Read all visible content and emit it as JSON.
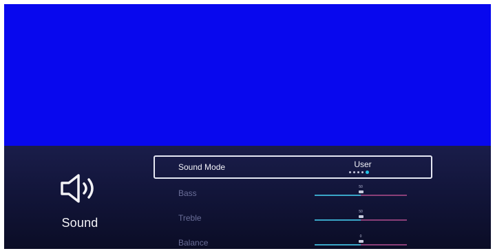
{
  "category": {
    "label": "Sound",
    "icon": "speaker-volume-icon"
  },
  "menu": {
    "sound_mode": {
      "label": "Sound Mode",
      "value": "User",
      "option_count": 5,
      "selected_index": 4
    },
    "bass": {
      "label": "Bass",
      "value": "50",
      "level": 0.5
    },
    "treble": {
      "label": "Treble",
      "value": "50",
      "level": 0.5
    },
    "balance": {
      "label": "Balance",
      "value": "0",
      "level": 0.5
    }
  },
  "colors": {
    "video_background": "#0808ee",
    "panel_background": "#12153a",
    "accent": "#22c4e8",
    "slider_track_left": "#3aa6c8",
    "slider_track_right": "#8b3f78"
  }
}
